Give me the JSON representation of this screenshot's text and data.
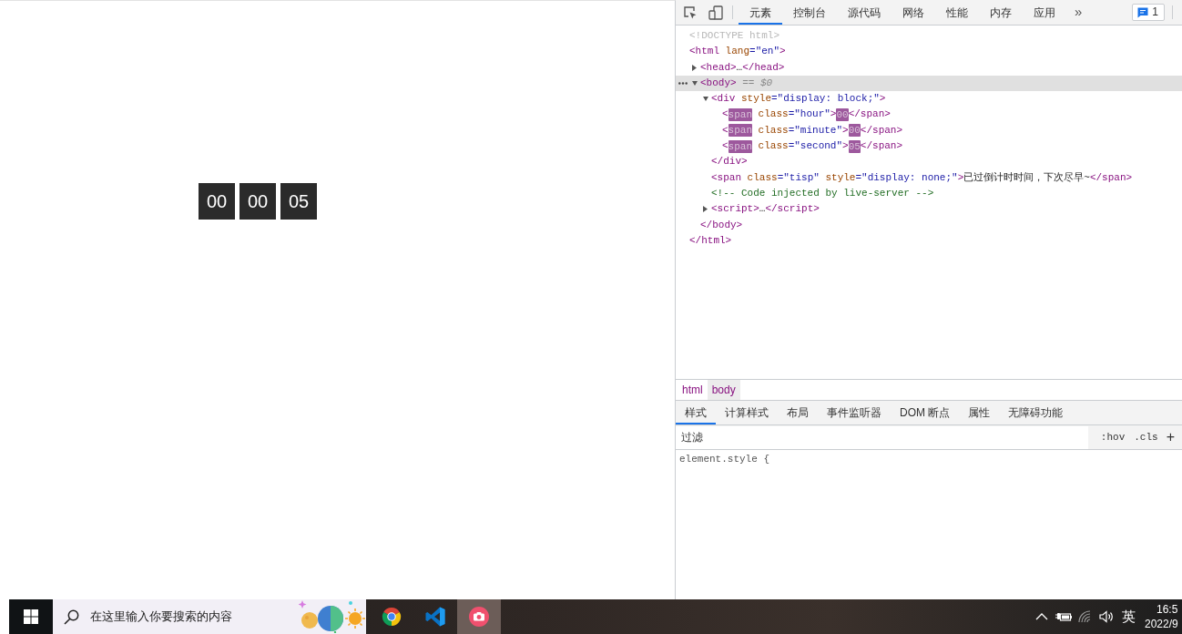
{
  "viewport": {
    "countdown": [
      "00",
      "00",
      "05"
    ]
  },
  "devtools": {
    "tabs": [
      {
        "label": "元素",
        "selected": true
      },
      {
        "label": "控制台",
        "selected": false
      },
      {
        "label": "源代码",
        "selected": false
      },
      {
        "label": "网络",
        "selected": false
      },
      {
        "label": "性能",
        "selected": false
      },
      {
        "label": "内存",
        "selected": false
      },
      {
        "label": "应用",
        "selected": false
      }
    ],
    "more_tabs": "»",
    "issues_count": "1",
    "dom_tree": [
      {
        "parts": [
          {
            "kind": "doctype",
            "text": "<!DOCTYPE html>"
          }
        ],
        "selected": false
      },
      {
        "parts": [
          {
            "kind": "tag",
            "text": "<html"
          },
          {
            "kind": "attr",
            "text": " lang"
          },
          {
            "kind": "value",
            "text": "=\"en\""
          },
          {
            "kind": "tag",
            "text": ">"
          }
        ],
        "selected": false,
        "children": [
          {
            "parts": [
              {
                "kind": "tag",
                "text": "<head>"
              },
              {
                "kind": "text",
                "text": "…"
              },
              {
                "kind": "tag",
                "text": "</head>"
              }
            ],
            "expanded": false,
            "selected": false
          },
          {
            "parts": [
              {
                "kind": "tag",
                "text": "<body>"
              },
              {
                "kind": "ref",
                "text": " == $0"
              }
            ],
            "expanded": true,
            "selected": true,
            "children": [
              {
                "parts": [
                  {
                    "kind": "tag",
                    "text": "<div"
                  },
                  {
                    "kind": "attr",
                    "text": " style"
                  },
                  {
                    "kind": "value",
                    "text": "=\"display: block;\""
                  },
                  {
                    "kind": "tag",
                    "text": ">"
                  }
                ],
                "expanded": true,
                "selected": false,
                "children": [
                  {
                    "parts": [
                      {
                        "kind": "tag",
                        "text": "<"
                      },
                      {
                        "kind": "match",
                        "text": "span"
                      },
                      {
                        "kind": "attr",
                        "text": " class"
                      },
                      {
                        "kind": "value",
                        "text": "=\"hour\""
                      },
                      {
                        "kind": "tag",
                        "text": ">"
                      },
                      {
                        "kind": "match",
                        "text": "00"
                      },
                      {
                        "kind": "tag",
                        "text": "</span>"
                      }
                    ],
                    "selected": false
                  },
                  {
                    "parts": [
                      {
                        "kind": "tag",
                        "text": "<"
                      },
                      {
                        "kind": "match",
                        "text": "span"
                      },
                      {
                        "kind": "attr",
                        "text": " class"
                      },
                      {
                        "kind": "value",
                        "text": "=\"minute\""
                      },
                      {
                        "kind": "tag",
                        "text": ">"
                      },
                      {
                        "kind": "match",
                        "text": "00"
                      },
                      {
                        "kind": "tag",
                        "text": "</span>"
                      }
                    ],
                    "selected": false
                  },
                  {
                    "parts": [
                      {
                        "kind": "tag",
                        "text": "<"
                      },
                      {
                        "kind": "match",
                        "text": "span"
                      },
                      {
                        "kind": "attr",
                        "text": " class"
                      },
                      {
                        "kind": "value",
                        "text": "=\"second\""
                      },
                      {
                        "kind": "tag",
                        "text": ">"
                      },
                      {
                        "kind": "match",
                        "text": "05"
                      },
                      {
                        "kind": "tag",
                        "text": "</span>"
                      }
                    ],
                    "selected": false
                  }
                ],
                "closing": [
                  {
                    "kind": "tag",
                    "text": "</div>"
                  }
                ]
              },
              {
                "parts": [
                  {
                    "kind": "tag",
                    "text": "<span"
                  },
                  {
                    "kind": "attr",
                    "text": " class"
                  },
                  {
                    "kind": "value",
                    "text": "=\"tisp\""
                  },
                  {
                    "kind": "attr",
                    "text": " style"
                  },
                  {
                    "kind": "value",
                    "text": "=\"display: none;\""
                  },
                  {
                    "kind": "tag",
                    "text": ">"
                  },
                  {
                    "kind": "text",
                    "text": "已过倒计时时间，下次尽早~"
                  },
                  {
                    "kind": "tag",
                    "text": "</span>"
                  }
                ],
                "selected": false
              },
              {
                "parts": [
                  {
                    "kind": "comment",
                    "text": "<!-- Code injected by live-server -->"
                  }
                ],
                "selected": false
              },
              {
                "parts": [
                  {
                    "kind": "tag",
                    "text": "<script>"
                  },
                  {
                    "kind": "text",
                    "text": "…"
                  },
                  {
                    "kind": "tag",
                    "text": "</script>"
                  }
                ],
                "expanded": false,
                "selected": false
              }
            ],
            "closing": [
              {
                "kind": "tag",
                "text": "</body>"
              }
            ]
          }
        ],
        "closing": [
          {
            "kind": "tag",
            "text": "</html>"
          }
        ]
      }
    ],
    "breadcrumbs": [
      {
        "label": "html",
        "selected": false
      },
      {
        "label": "body",
        "selected": true
      }
    ],
    "styles_tabs": [
      {
        "label": "样式",
        "selected": true
      },
      {
        "label": "计算样式",
        "selected": false
      },
      {
        "label": "布局",
        "selected": false
      },
      {
        "label": "事件监听器",
        "selected": false
      },
      {
        "label": "DOM 断点",
        "selected": false
      },
      {
        "label": "属性",
        "selected": false
      },
      {
        "label": "无障碍功能",
        "selected": false
      }
    ],
    "filter": {
      "placeholder": "过滤"
    },
    "filter_buttons": [
      ":hov",
      ".cls",
      "+"
    ],
    "style_rules": [
      "element.style {"
    ]
  },
  "taskbar": {
    "search": {
      "placeholder": "在这里输入你要搜索的内容"
    },
    "apps": [
      {
        "kind": "browser",
        "selected": false
      },
      {
        "kind": "code-editor",
        "selected": false
      },
      {
        "kind": "camera",
        "selected": true
      }
    ],
    "tray": {
      "input_method": "英",
      "time": "16:5",
      "date": "2022/9"
    }
  }
}
